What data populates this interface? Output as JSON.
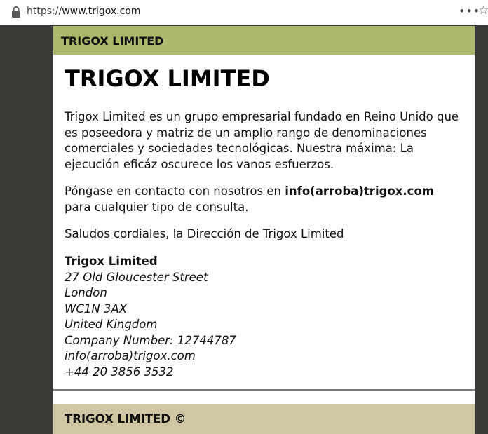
{
  "browser": {
    "url_scheme": "https://",
    "url_host": "www.trigox.com",
    "more_icon": "•••",
    "star_icon": "☆"
  },
  "page": {
    "top_band_title": "TRIGOX LIMITED",
    "heading": "TRIGOX LIMITED",
    "paragraph1": "Trigox Limited es un grupo empresarial fundado en Reino Unido que es poseedora y matriz de un amplio rango de denominaciones comerciales y sociedades tecnológicas. Nuestra máxima: La ejecución eficáz oscurece los vanos esfuerzos.",
    "contact_prefix": "Póngase en contacto con nosotros en",
    "contact_email": "info(arroba)trigox.com",
    "contact_suffix": "para cualquier tipo de consulta.",
    "greeting": "Saludos cordiales, la Dirección de Trigox Limited",
    "address": {
      "company": "Trigox Limited",
      "street": "27 Old Gloucester Street",
      "city": "London",
      "postcode": "WC1N 3AX",
      "country": "United Kingdom",
      "company_number": "Company Number: 12744787",
      "email": "info(arroba)trigox.com",
      "phone": "+44 20 3856 3532"
    },
    "footer": "TRIGOX LIMITED ©"
  },
  "colors": {
    "top_band": "#aeb86d",
    "footer_band": "#cfc7a3",
    "side_background": "#3a3a36"
  }
}
